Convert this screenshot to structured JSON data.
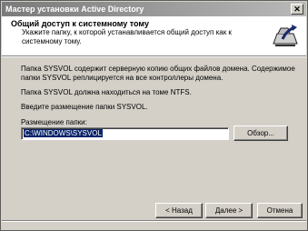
{
  "window": {
    "title": "Мастер установки Active Directory",
    "close_glyph": "✕"
  },
  "header": {
    "title": "Общий доступ к системному тому",
    "description": "Укажите папку, к которой устанавливается общий доступ как к системному тому.",
    "icon": "share-folder-icon"
  },
  "body": {
    "paragraph1": "Папка SYSVOL содержит серверную копию общих файлов домена. Содержимое",
    "paragraph1b": "папки SYSVOL реплицируется на все контроллеры домена.",
    "paragraph2": "Папка SYSVOL должна находиться на томе NTFS.",
    "paragraph3": "Введите размещение папки SYSVOL.",
    "folder_label": "Размещение папки:",
    "folder_value": "C:\\WINDOWS\\SYSVOL",
    "browse_label": "Обзор..."
  },
  "footer": {
    "back_label": "< Назад",
    "next_label": "Далее >",
    "cancel_label": "Отмена"
  },
  "colors": {
    "titlebar": "#8a8a8a",
    "dialog_face": "#d4d0c8",
    "selection": "#0a246a"
  }
}
